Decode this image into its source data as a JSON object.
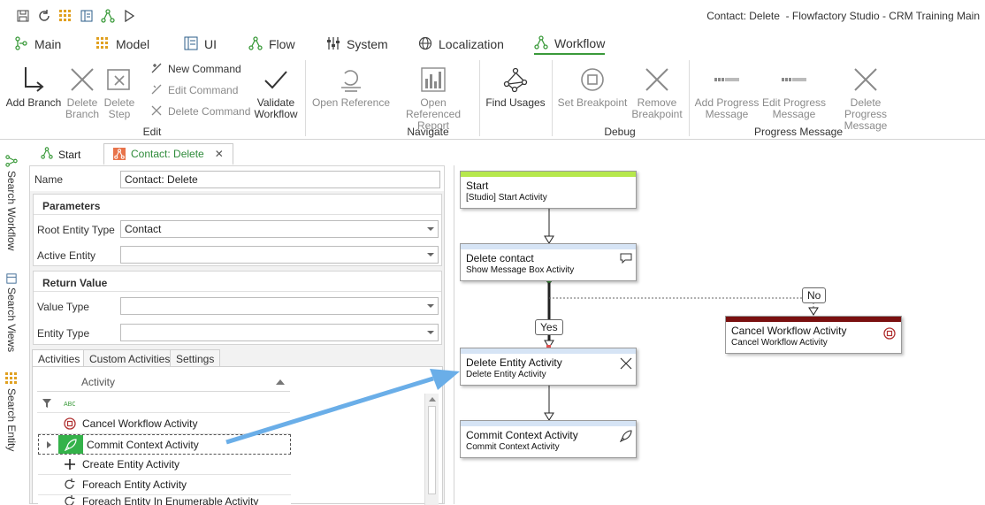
{
  "app": {
    "title": "Contact: Delete  - Flowfactory Studio - CRM Training Main",
    "quick_access": [
      "save-icon",
      "refresh-icon",
      "entity-grid-icon",
      "view-icon",
      "flow-icon",
      "run-icon"
    ]
  },
  "tabs": [
    {
      "label": "Main",
      "icon": "main-icon"
    },
    {
      "label": "Model",
      "icon": "model-icon"
    },
    {
      "label": "UI",
      "icon": "ui-icon"
    },
    {
      "label": "Flow",
      "icon": "flow-icon"
    },
    {
      "label": "System",
      "icon": "system-icon"
    },
    {
      "label": "Localization",
      "icon": "globe-icon"
    },
    {
      "label": "Workflow",
      "icon": "workflow-icon",
      "active": true
    }
  ],
  "ribbon": {
    "edit": {
      "label": "Edit",
      "add_branch": "Add Branch",
      "delete_branch_1": "Delete",
      "delete_branch_2": "Branch",
      "delete_step_1": "Delete",
      "delete_step_2": "Step",
      "new_command": "New Command",
      "edit_command": "Edit Command",
      "delete_command": "Delete Command",
      "validate_1": "Validate",
      "validate_2": "Workflow"
    },
    "navigate": {
      "label": "Navigate",
      "open_reference": "Open Reference",
      "open_referenced_1": "Open Referenced",
      "open_referenced_2": "Report",
      "find_usages": "Find Usages"
    },
    "debug": {
      "label": "Debug",
      "set_breakpoint": "Set Breakpoint",
      "remove_breakpoint_1": "Remove",
      "remove_breakpoint_2": "Breakpoint"
    },
    "progress": {
      "label": "Progress Message",
      "add_1": "Add Progress",
      "add_2": "Message",
      "edit_1": "Edit Progress",
      "edit_2": "Message",
      "delete_1": "Delete Progress",
      "delete_2": "Message"
    }
  },
  "sidebar": {
    "search_workflow": "Search Workflow",
    "search_views": "Search Views",
    "search_entity": "Search Entity"
  },
  "doc_tabs": {
    "start": "Start",
    "active": "Contact: Delete"
  },
  "properties": {
    "name_label": "Name",
    "name_value": "Contact: Delete",
    "parameters_title": "Parameters",
    "root_entity_label": "Root Entity Type",
    "root_entity_value": "Contact",
    "active_entity_label": "Active Entity",
    "active_entity_value": "",
    "return_title": "Return Value",
    "value_type_label": "Value Type",
    "value_type_value": "",
    "entity_type_label": "Entity Type",
    "entity_type_value": ""
  },
  "activities": {
    "tabs": [
      "Activities",
      "Custom Activities",
      "Settings"
    ],
    "column_header": "Activity",
    "filter_icon": "abc-filter-icon",
    "rows": [
      {
        "label": "Cancel Workflow Activity",
        "icon": "stop-circle-icon"
      },
      {
        "label": "Commit Context Activity",
        "icon": "rocket-icon",
        "selected": true
      },
      {
        "label": "Create Entity Activity",
        "icon": "plus-icon"
      },
      {
        "label": "Foreach Entity Activity",
        "icon": "loop-icon"
      },
      {
        "label": "Foreach Entity In Enumerable Activity",
        "icon": "loop-icon"
      }
    ]
  },
  "workflow": {
    "nodes": {
      "start": {
        "title": "Start",
        "sub": "[Studio] Start Activity",
        "color": "#b6e84c"
      },
      "delete_contact": {
        "title": "Delete contact",
        "sub": "Show Message Box  Activity",
        "color": "#d6e4f5"
      },
      "delete_entity": {
        "title": "Delete Entity Activity",
        "sub": "Delete Entity Activity",
        "color": "#d6e4f5"
      },
      "commit": {
        "title": "Commit Context Activity",
        "sub": "Commit Context Activity",
        "color": "#d6e4f5"
      },
      "cancel": {
        "title": "Cancel Workflow Activity",
        "sub": "Cancel Workflow Activity",
        "color": "#7a1010"
      }
    },
    "yes_label": "Yes",
    "no_label": "No"
  },
  "colors": {
    "accent_green": "#3a9a3a",
    "drag_arrow": "#6aaee8",
    "selected_row": "#34b24a"
  }
}
